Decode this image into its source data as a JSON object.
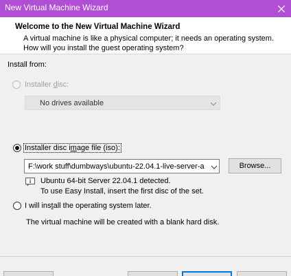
{
  "window": {
    "title": "New Virtual Machine Wizard",
    "close_icon": "close-icon"
  },
  "header": {
    "title": "Welcome to the New Virtual Machine Wizard",
    "description": "A virtual machine is like a physical computer; it needs an operating system. How will you install the guest operating system?"
  },
  "install_from": {
    "label": "Install from:",
    "options": [
      {
        "label_prefix": "Installer ",
        "label_underlined": "d",
        "label_suffix": "isc:",
        "selected": false,
        "enabled": false
      },
      {
        "label_prefix": "Installer disc i",
        "label_underlined": "m",
        "label_suffix": "age file (iso):",
        "selected": true,
        "enabled": true
      },
      {
        "label_prefix": "I will ins",
        "label_underlined": "t",
        "label_suffix": "all the operating system later.",
        "selected": false,
        "enabled": true
      }
    ],
    "disc_dropdown_value": "No drives available",
    "iso_path": "F:\\work stuff\\dumbways\\ubuntu-22.04.1-live-server-a",
    "browse_label": "Browse...",
    "detected_line1": "Ubuntu 64-bit Server 22.04.1 detected.",
    "detected_line2": "To use Easy Install, insert the first disc of the set.",
    "later_description": "The virtual machine will be created with a blank hard disk."
  },
  "colors": {
    "titlebar": "#b04fd4",
    "accent": "#0078d7"
  }
}
